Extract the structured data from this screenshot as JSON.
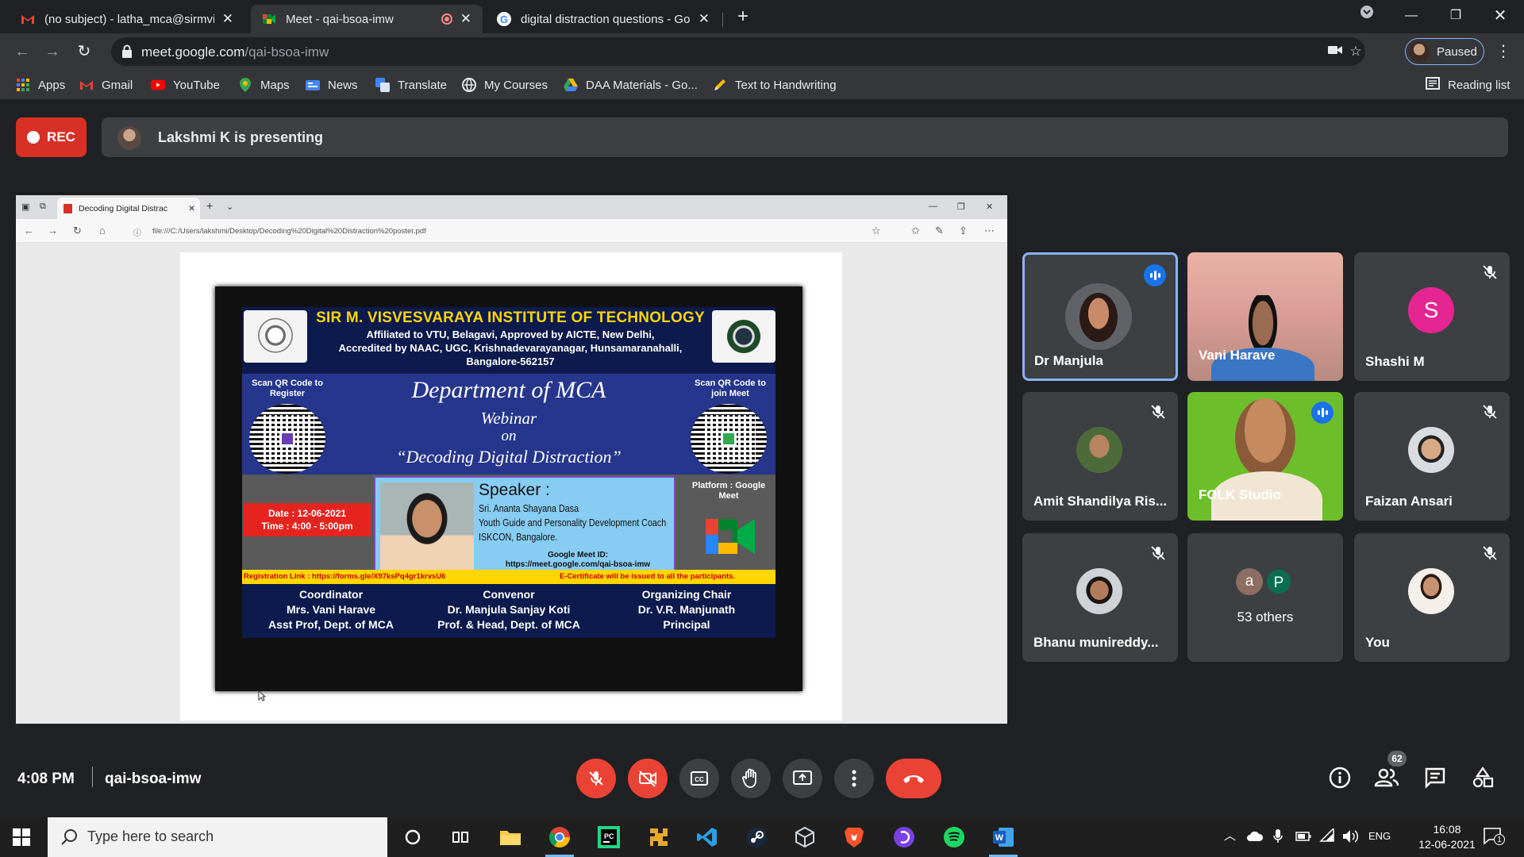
{
  "browser": {
    "tabs": [
      {
        "title": "(no subject) - latha_mca@sirmvit"
      },
      {
        "title": "Meet - qai-bsoa-imw"
      },
      {
        "title": "digital distraction questions - Go"
      }
    ],
    "url_host": "meet.google.com",
    "url_path": "/qai-bsoa-imw",
    "profile_label": "Paused",
    "bookmarks": [
      "Apps",
      "Gmail",
      "YouTube",
      "Maps",
      "News",
      "Translate",
      "My Courses",
      "DAA Materials - Go...",
      "Text to Handwriting"
    ],
    "reading_list": "Reading list"
  },
  "meet": {
    "rec_label": "REC",
    "presenting_text": "Lakshmi K is presenting",
    "meeting_time": "4:08 PM",
    "meeting_code": "qai-bsoa-imw",
    "people_count": "62",
    "participants": [
      {
        "name": "Dr Manjula",
        "state": "speaking"
      },
      {
        "name": "Vani Harave",
        "state": "video"
      },
      {
        "name": "Shashi M",
        "initial": "S",
        "state": "muted"
      },
      {
        "name": "Amit Shandilya Ris...",
        "state": "muted"
      },
      {
        "name": "FOLK Studio",
        "state": "speaking"
      },
      {
        "name": "Faizan Ansari",
        "state": "muted"
      },
      {
        "name": "Bhanu munireddy...",
        "state": "muted"
      },
      {
        "name": "53 others",
        "initials": [
          "a",
          "P"
        ]
      },
      {
        "name": "You",
        "state": "muted"
      }
    ]
  },
  "shared": {
    "tab_title": "Decoding Digital Distrac",
    "file_url": "file:///C:/Users/lakshmi/Desktop/Decoding%20Digital%20Distraction%20poster.pdf",
    "poster": {
      "institute": "SIR M. VISVESVARAYA INSTITUTE OF TECHNOLOGY",
      "affiliation1": "Affiliated to VTU, Belagavi, Approved by AICTE, New Delhi,",
      "affiliation2": "Accredited by NAAC, UGC, Krishnadevarayanagar, Hunsamaranahalli,",
      "affiliation3": "Bangalore-562157",
      "qr_left": "Scan QR Code to Register",
      "qr_right": "Scan QR Code to join Meet",
      "department": "Department of MCA",
      "webinar": "Webinar",
      "on": "on",
      "topic": "“Decoding Digital Distraction”",
      "date": "Date : 12-06-2021",
      "time": "Time : 4:00 - 5:00pm",
      "speaker_heading": "Speaker :",
      "speaker_name": "Sri. Ananta Shayana Dasa",
      "speaker_role": "Youth Guide and Personality Development Coach",
      "speaker_org": "ISKCON, Bangalore.",
      "meet_id_label": "Google Meet ID:",
      "meet_id_url": "https://meet.google.com/qai-bsoa-imw",
      "platform": "Platform : Google Meet",
      "reg_link": "Registration Link : https://forms.gle/X97ksPq4gr1krvsU6",
      "ecert": "E-Certificate will be issued to all the participants.",
      "coordinator_role": "Coordinator",
      "coordinator_name": "Mrs. Vani Harave",
      "coordinator_title": "Asst Prof, Dept. of MCA",
      "convenor_role": "Convenor",
      "convenor_name": "Dr. Manjula Sanjay Koti",
      "convenor_title": "Prof. & Head, Dept. of MCA",
      "chair_role": "Organizing Chair",
      "chair_name": "Dr. V.R. Manjunath",
      "chair_title": "Principal"
    }
  },
  "taskbar": {
    "search_placeholder": "Type here to search",
    "language": "ENG",
    "clock_time": "16:08",
    "clock_date": "12-06-2021",
    "notification_count": "1"
  },
  "colors": {
    "rec": "#d93025",
    "accent": "#8ab4f8",
    "end_call": "#ea4335",
    "tile": "#3c4043"
  }
}
